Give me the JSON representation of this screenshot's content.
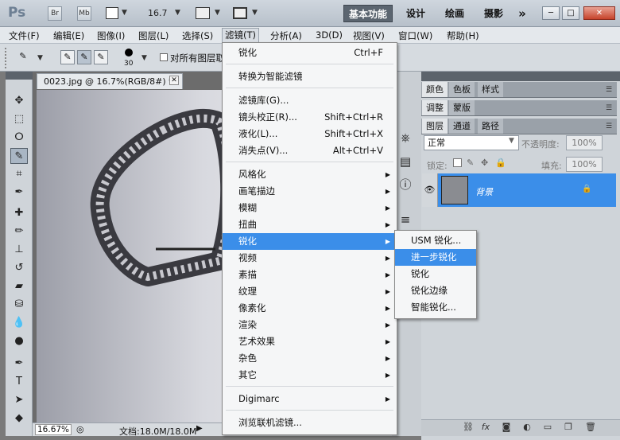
{
  "app": {
    "logo": "Ps",
    "bridge": "Br",
    "minibridge": "Mb",
    "zoom": "16.7"
  },
  "workspaces": [
    "基本功能",
    "设计",
    "绘画",
    "摄影",
    "»"
  ],
  "window_controls": {
    "minimize": "─",
    "maximize": "□",
    "close": "✕"
  },
  "menubar": [
    "文件(F)",
    "编辑(E)",
    "图像(I)",
    "图层(L)",
    "选择(S)",
    "滤镜(T)",
    "分析(A)",
    "3D(D)",
    "视图(V)",
    "窗口(W)",
    "帮助(H)"
  ],
  "options": {
    "brush_size": "30",
    "sample_all_label": "对所有图层取"
  },
  "document": {
    "tab_title": "0023.jpg @ 16.7%(RGB/8#) *",
    "zoom": "16.67%",
    "info": "文档:18.0M/18.0M"
  },
  "filter_menu": {
    "items": [
      {
        "label": "锐化",
        "shortcut": "Ctrl+F"
      },
      {
        "label": "转换为智能滤镜"
      },
      {
        "label": "滤镜库(G)..."
      },
      {
        "label": "镜头校正(R)...",
        "shortcut": "Shift+Ctrl+R"
      },
      {
        "label": "液化(L)...",
        "shortcut": "Shift+Ctrl+X"
      },
      {
        "label": "消失点(V)...",
        "shortcut": "Alt+Ctrl+V"
      },
      {
        "label": "风格化"
      },
      {
        "label": "画笔描边"
      },
      {
        "label": "模糊"
      },
      {
        "label": "扭曲"
      },
      {
        "label": "锐化",
        "highlighted": true
      },
      {
        "label": "视频"
      },
      {
        "label": "素描"
      },
      {
        "label": "纹理"
      },
      {
        "label": "像素化"
      },
      {
        "label": "渲染"
      },
      {
        "label": "艺术效果"
      },
      {
        "label": "杂色"
      },
      {
        "label": "其它"
      },
      {
        "label": "Digimarc"
      },
      {
        "label": "浏览联机滤镜..."
      }
    ]
  },
  "sharpen_submenu": [
    {
      "label": "USM 锐化..."
    },
    {
      "label": "进一步锐化",
      "highlighted": true
    },
    {
      "label": "锐化"
    },
    {
      "label": "锐化边缘"
    },
    {
      "label": "智能锐化..."
    }
  ],
  "panels": {
    "top_tabs": [
      "颜色",
      "色板",
      "样式"
    ],
    "mid_tabs": [
      "调整",
      "蒙版"
    ],
    "layer_tabs": [
      "图层",
      "通道",
      "路径"
    ],
    "blend_mode": "正常",
    "opacity_label": "不透明度:",
    "opacity_value": "100%",
    "lock_label": "锁定:",
    "fill_label": "填充:",
    "fill_value": "100%",
    "layer_name": "背景"
  },
  "colors": {
    "highlight": "#3b8ee9",
    "workspace_active": "#5b6570"
  }
}
